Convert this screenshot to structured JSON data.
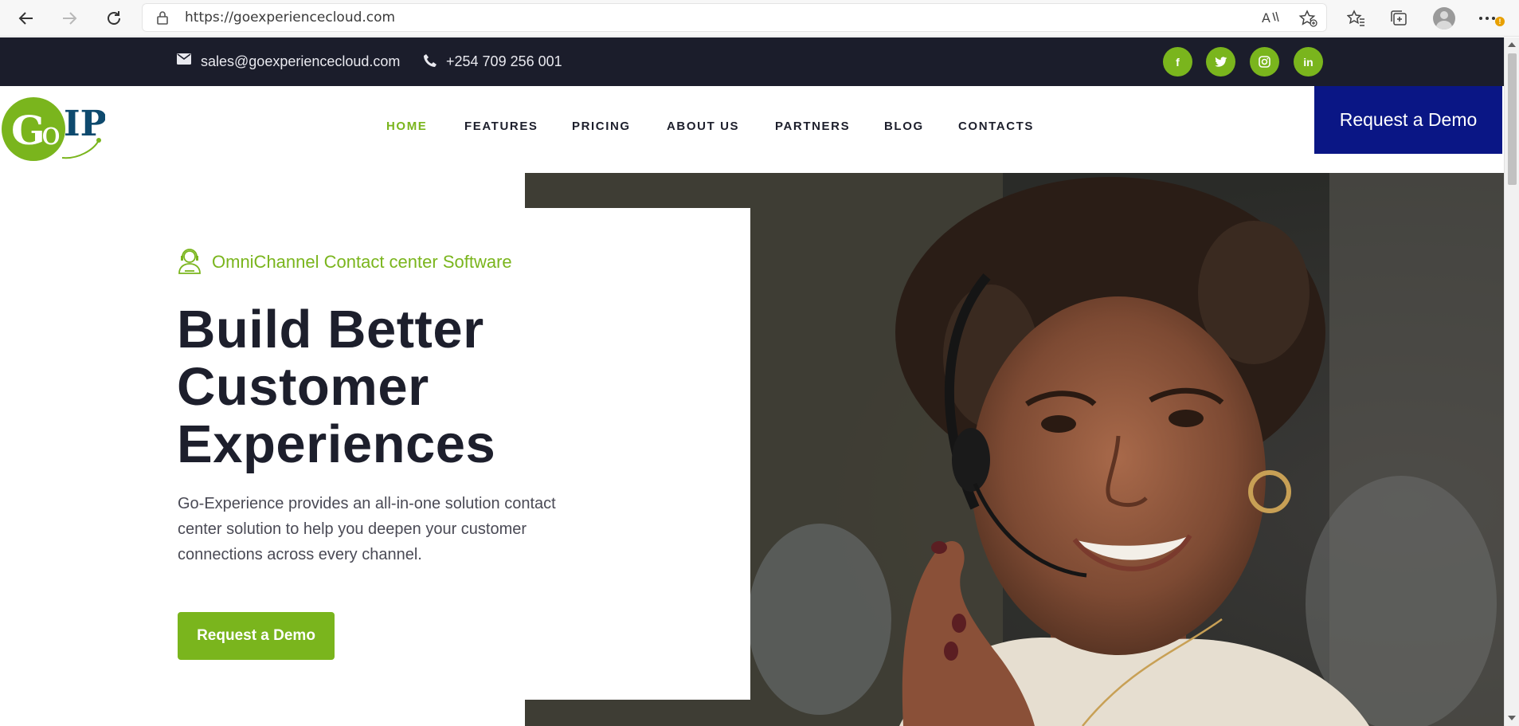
{
  "browser": {
    "url": "https://goexperiencecloud.com",
    "profile_badge": "!"
  },
  "topbar": {
    "email": "sales@goexperiencecloud.com",
    "phone": "+254 709 256 001",
    "social": [
      {
        "name": "facebook",
        "glyph": "f"
      },
      {
        "name": "twitter",
        "glyph": "t"
      },
      {
        "name": "instagram",
        "glyph": "◎"
      },
      {
        "name": "linkedin",
        "glyph": "in"
      }
    ]
  },
  "header": {
    "logo_text": "GoIP",
    "nav": [
      {
        "label": "HOME",
        "active": true
      },
      {
        "label": "FEATURES"
      },
      {
        "label": "PRICING"
      },
      {
        "label": "ABOUT US"
      },
      {
        "label": "PARTNERS"
      },
      {
        "label": "BLOG"
      },
      {
        "label": "CONTACTS"
      }
    ],
    "demo_button": "Request a Demo"
  },
  "hero": {
    "subtitle": "OmniChannel Contact center Software",
    "headline": [
      "Build Better",
      "Customer",
      "Experiences"
    ],
    "description": "Go-Experience provides an all-in-one solution contact center solution to help you deepen your customer connections across every channel.",
    "cta": "Request a Demo"
  },
  "colors": {
    "accent_green": "#7ab51d",
    "dark_navy": "#1b1d2b",
    "demo_blue": "#0a1685"
  }
}
